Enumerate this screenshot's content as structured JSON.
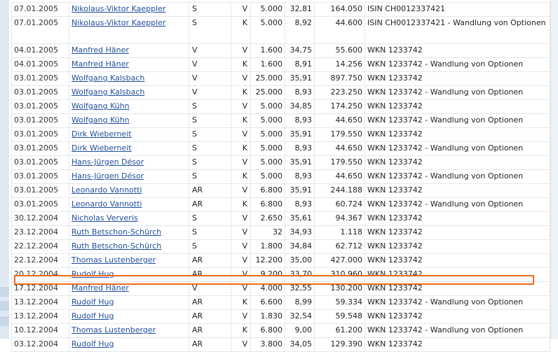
{
  "highlight_color": "#f26a1b",
  "rows": [
    {
      "date": "07.01.2005",
      "name": "Nikolaus-Viktor Kaeppler",
      "role": "S",
      "type": "V",
      "qty": "5.000",
      "price": "32,81",
      "total": "164.050",
      "desc": "ISIN CH0012337421"
    },
    {
      "date": "07.01.2005",
      "name": "Nikolaus-Viktor Kaeppler",
      "role": "S",
      "type": "K",
      "qty": "5.000",
      "price": "8,92",
      "total": "44.600",
      "desc": "ISIN CH0012337421 - Wandlung von Optionen"
    },
    {
      "date": "04.01.2005",
      "name": "Manfred Häner",
      "role": "V",
      "type": "V",
      "qty": "1.600",
      "price": "34,75",
      "total": "55.600",
      "desc": "WKN 1233742"
    },
    {
      "date": "04.01.2005",
      "name": "Manfred Häner",
      "role": "V",
      "type": "K",
      "qty": "1.600",
      "price": "8,91",
      "total": "14.256",
      "desc": "WKN 1233742 - Wandlung von Optionen"
    },
    {
      "date": "03.01.2005",
      "name": "Wolfgang Kalsbach",
      "role": "V",
      "type": "V",
      "qty": "25.000",
      "price": "35,91",
      "total": "897.750",
      "desc": "WKN 1233742"
    },
    {
      "date": "03.01.2005",
      "name": "Wolfgang Kalsbach",
      "role": "V",
      "type": "K",
      "qty": "25.000",
      "price": "8,93",
      "total": "223.250",
      "desc": "WKN 1233742 - Wandlung von Optionen"
    },
    {
      "date": "03.01.2005",
      "name": "Wolfgang Kühn",
      "role": "S",
      "type": "V",
      "qty": "5.000",
      "price": "34,85",
      "total": "174.250",
      "desc": "WKN 1233742"
    },
    {
      "date": "03.01.2005",
      "name": "Wolfgang Kühn",
      "role": "S",
      "type": "K",
      "qty": "5.000",
      "price": "8,93",
      "total": "44.650",
      "desc": "WKN 1233742 - Wandlung von Optionen"
    },
    {
      "date": "03.01.2005",
      "name": "Dirk Wieberneit",
      "role": "S",
      "type": "V",
      "qty": "5.000",
      "price": "35,91",
      "total": "179.550",
      "desc": "WKN 1233742"
    },
    {
      "date": "03.01.2005",
      "name": "Dirk Wieberneit",
      "role": "S",
      "type": "K",
      "qty": "5.000",
      "price": "8,93",
      "total": "44.650",
      "desc": "WKN 1233742 - Wandlung von Optionen"
    },
    {
      "date": "03.01.2005",
      "name": "Hans-Jürgen Désor",
      "role": "S",
      "type": "V",
      "qty": "5.000",
      "price": "35,91",
      "total": "179.550",
      "desc": "WKN 1233742"
    },
    {
      "date": "03.01.2005",
      "name": "Hans-Jürgen Désor",
      "role": "S",
      "type": "K",
      "qty": "5.000",
      "price": "8,93",
      "total": "44.650",
      "desc": "WKN 1233742 - Wandlung von Optionen"
    },
    {
      "date": "03.01.2005",
      "name": "Leonardo Vannotti",
      "role": "AR",
      "type": "V",
      "qty": "6.800",
      "price": "35,91",
      "total": "244.188",
      "desc": "WKN 1233742"
    },
    {
      "date": "03.01.2005",
      "name": "Leonardo Vannotti",
      "role": "AR",
      "type": "K",
      "qty": "6.800",
      "price": "8,93",
      "total": "60.724",
      "desc": "WKN 1233742 - Wandlung von Optionen"
    },
    {
      "date": "30.12.2004",
      "name": "Nicholas Ververis",
      "role": "S",
      "type": "V",
      "qty": "2.650",
      "price": "35,61",
      "total": "94.367",
      "desc": "WKN 1233742"
    },
    {
      "date": "23.12.2004",
      "name": "Ruth Betschon-Schürch",
      "role": "S",
      "type": "V",
      "qty": "32",
      "price": "34,93",
      "total": "1.118",
      "desc": "WKN 1233742"
    },
    {
      "date": "22.12.2004",
      "name": "Ruth Betschon-Schürch",
      "role": "S",
      "type": "V",
      "qty": "1.800",
      "price": "34,84",
      "total": "62.712",
      "desc": "WKN 1233742"
    },
    {
      "date": "22.12.2004",
      "name": "Thomas Lustenberger",
      "role": "AR",
      "type": "V",
      "qty": "12.200",
      "price": "35,00",
      "total": "427.000",
      "desc": "WKN 1233742"
    },
    {
      "date": "20.12.2004",
      "name": "Rudolf Hug",
      "role": "AR",
      "type": "V",
      "qty": "9.200",
      "price": "33,70",
      "total": "310.960",
      "desc": "WKN 1233742"
    },
    {
      "date": "17.12.2004",
      "name": "Manfred Häner",
      "role": "V",
      "type": "V",
      "qty": "4.000",
      "price": "32,55",
      "total": "130.200",
      "desc": "WKN 1233742"
    },
    {
      "date": "13.12.2004",
      "name": "Rudolf Hug",
      "role": "AR",
      "type": "K",
      "qty": "6.600",
      "price": "8,99",
      "total": "59.334",
      "desc": "WKN 1233742 - Wandlung von Optionen"
    },
    {
      "date": "13.12.2004",
      "name": "Rudolf Hug",
      "role": "AR",
      "type": "V",
      "qty": "1.830",
      "price": "32,54",
      "total": "59.548",
      "desc": "WKN 1233742"
    },
    {
      "date": "10.12.2004",
      "name": "Thomas Lustenberger",
      "role": "AR",
      "type": "K",
      "qty": "6.800",
      "price": "9,00",
      "total": "61.200",
      "desc": "WKN 1233742 - Wandlung von Optionen"
    },
    {
      "date": "03.12.2004",
      "name": "Rudolf Hug",
      "role": "AR",
      "type": "V",
      "qty": "3.800",
      "price": "34,05",
      "total": "129.390",
      "desc": "WKN 1233742"
    }
  ]
}
